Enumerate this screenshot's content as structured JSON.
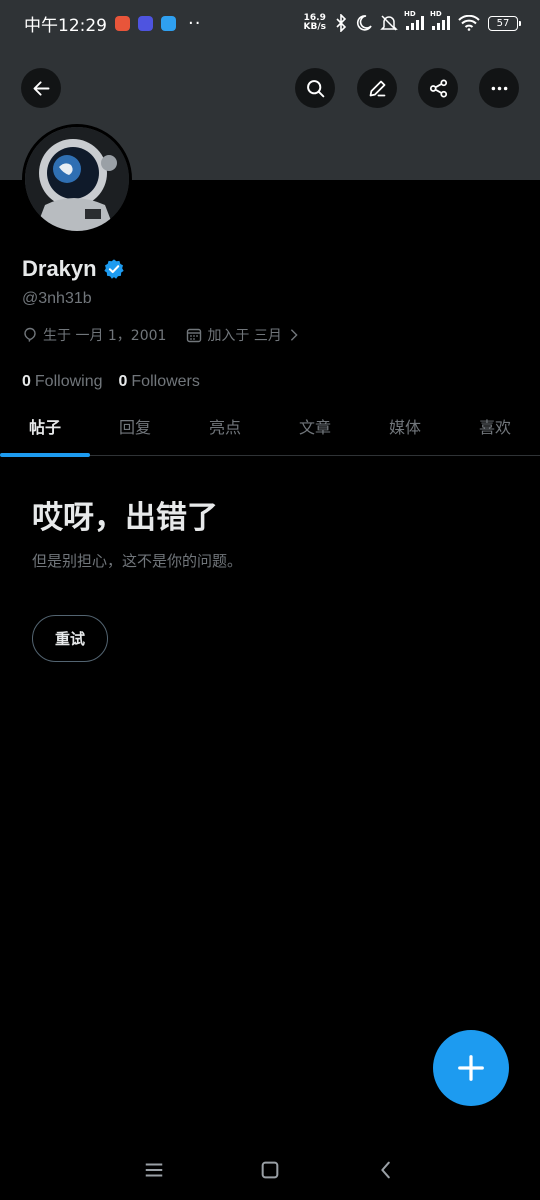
{
  "status_bar": {
    "time": "中午12:29",
    "net_speed_value": "16.9",
    "net_speed_unit": "KB/s",
    "signal_1_label": "HD",
    "signal_2_label": "HD",
    "battery": "57",
    "app_icon_colors": [
      "#e8553a",
      "#4e54e0",
      "#2fa0f0"
    ]
  },
  "header": {
    "back_icon": "arrow-left-icon",
    "search_icon": "search-icon",
    "edit_icon": "pencil-icon",
    "share_icon": "share-icon",
    "more_icon": "more-horizontal-icon"
  },
  "profile": {
    "display_name": "Drakyn",
    "verified": true,
    "handle": "@3nh31b",
    "birth": "生于 一月 1，2001",
    "joined": "加入于 三月",
    "following_count": "0",
    "following_label": "Following",
    "followers_count": "0",
    "followers_label": "Followers"
  },
  "tabs": [
    {
      "label": "帖子",
      "active": true
    },
    {
      "label": "回复",
      "active": false
    },
    {
      "label": "亮点",
      "active": false
    },
    {
      "label": "文章",
      "active": false
    },
    {
      "label": "媒体",
      "active": false
    },
    {
      "label": "喜欢",
      "active": false
    }
  ],
  "error": {
    "title": "哎呀，出错了",
    "subtitle": "但是别担心，这不是你的问题。",
    "retry_label": "重试"
  },
  "fab_icon": "plus-icon",
  "colors": {
    "accent": "#1d9bf0",
    "background": "#000000",
    "banner": "#2f3336",
    "text_primary": "#e7e9ea",
    "text_secondary": "#71767b"
  }
}
